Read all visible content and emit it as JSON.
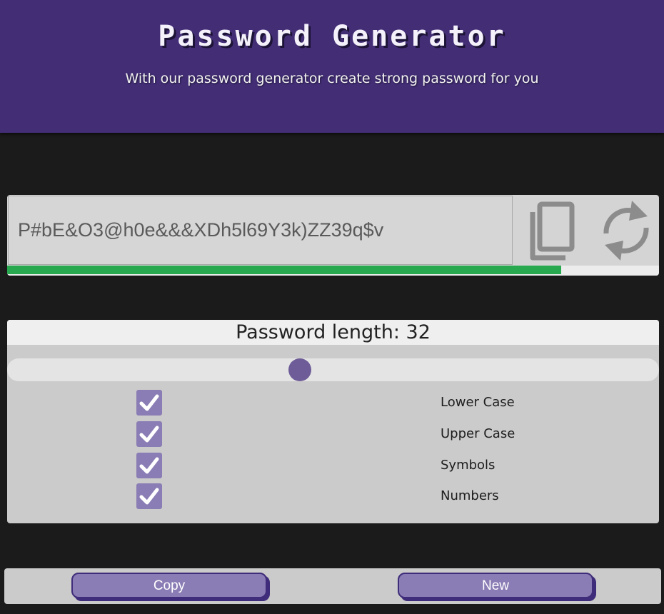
{
  "header": {
    "title": "Password Generator",
    "subtitle": "With our password generator create strong password for you"
  },
  "password": {
    "value": "P#bE&O3@h0e&&&XDh5l69Y3k)ZZ39q$v",
    "strength_fraction": 0.85,
    "copy_icon": "copy-icon",
    "refresh_icon": "refresh-icon"
  },
  "settings": {
    "length_label": "Password length: 32",
    "length_value": 32,
    "options": [
      {
        "label": "Lower Case",
        "checked": true
      },
      {
        "label": "Upper Case",
        "checked": true
      },
      {
        "label": "Symbols",
        "checked": true
      },
      {
        "label": "Numbers",
        "checked": true
      }
    ]
  },
  "buttons": {
    "copy_label": "Copy",
    "new_label": "New"
  },
  "colors": {
    "header_bg": "#432e76",
    "page_bg": "#1b1b1b",
    "accent": "#8a7cb4",
    "strength": "#28a84f"
  }
}
